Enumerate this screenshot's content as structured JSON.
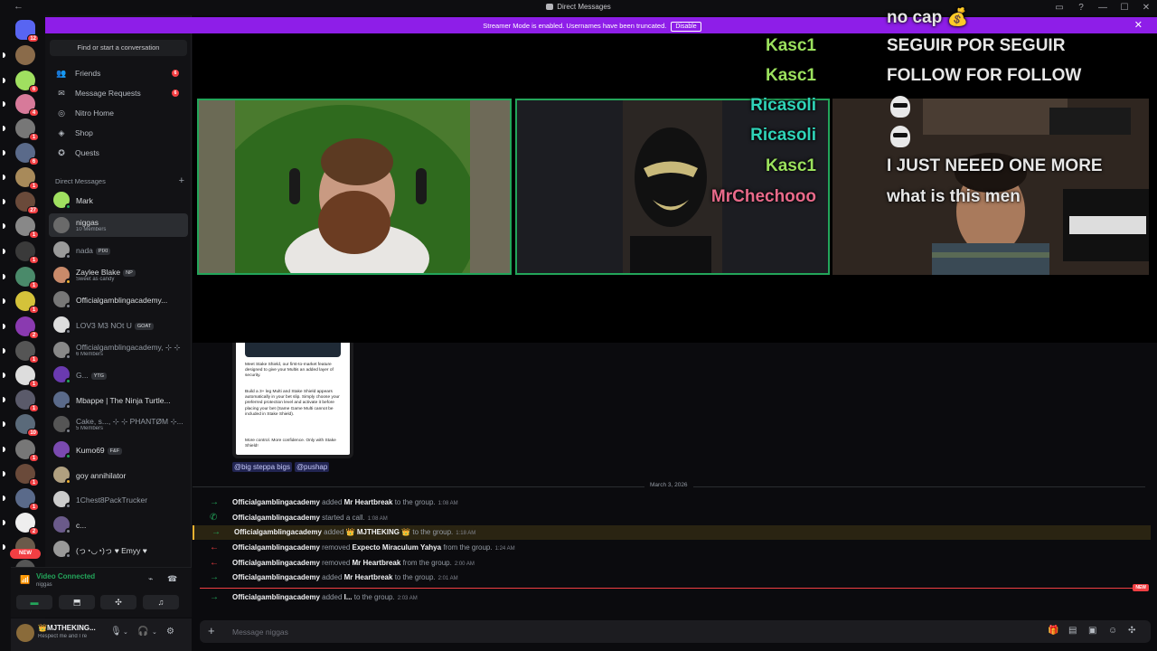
{
  "titlebar": {
    "back": "←",
    "title": "Direct Messages",
    "controls": [
      "▭",
      "?",
      "—",
      "☐",
      "✕"
    ]
  },
  "banner": {
    "text": "Streamer Mode is enabled. Usernames have been truncated.",
    "button": "Disable",
    "close": "✕"
  },
  "rail": {
    "badges": [
      "12",
      "",
      "6",
      "4",
      "1",
      "6",
      "1",
      "27",
      "1",
      "1",
      "1",
      "1",
      "2",
      "1",
      "1",
      "1",
      "10",
      "1",
      "1",
      "1",
      "2",
      "1",
      "1",
      "1"
    ],
    "new_pill": "NEW"
  },
  "sidebar": {
    "search_label": "Find or start a conversation",
    "nav": [
      {
        "label": "Friends",
        "count": "6"
      },
      {
        "label": "Message Requests",
        "count": "6"
      },
      {
        "label": "Nitro Home",
        "count": ""
      },
      {
        "label": "Shop",
        "count": ""
      },
      {
        "label": "Quests",
        "count": ""
      }
    ],
    "dm_header": "Direct Messages",
    "dms": [
      {
        "name": "Mark",
        "sub": "",
        "tag": ""
      },
      {
        "name": "niggas",
        "sub": "10 Members",
        "tag": ""
      },
      {
        "name": "nada",
        "sub": "",
        "tag": "PIXI"
      },
      {
        "name": "Zaylee Blake",
        "sub": "Sweet as candy",
        "tag": "NP"
      },
      {
        "name": "Officialgamblingacademy...",
        "sub": "",
        "tag": ""
      },
      {
        "name": "LOV3 M3 NOt U",
        "sub": "",
        "tag": "GOAT"
      },
      {
        "name": "Officialgamblingacademy, ⊹ ⊹",
        "sub": "6 Members",
        "tag": ""
      },
      {
        "name": "G...",
        "sub": "",
        "tag": "YTG"
      },
      {
        "name": "Mbappe | The Ninja Turtle...",
        "sub": "",
        "tag": ""
      },
      {
        "name": "Cake, s..., ⊹ ⊹ PHANTØM ⊹...",
        "sub": "5 Members",
        "tag": ""
      },
      {
        "name": "Kumo69",
        "sub": "",
        "tag": "F&F"
      },
      {
        "name": "goy annihilator",
        "sub": "",
        "tag": ""
      },
      {
        "name": "1Chest8PackTrucker",
        "sub": "",
        "tag": ""
      },
      {
        "name": "c...",
        "sub": "",
        "tag": ""
      },
      {
        "name": "(っ◔◡◔)っ ♥ Emyy ♥",
        "sub": "",
        "tag": ""
      }
    ]
  },
  "voice": {
    "title": "Video Connected",
    "channel": "niggas"
  },
  "user": {
    "name": "👑MJTHEKING...",
    "status": "Respect me and I re"
  },
  "overlay_chat": [
    {
      "user": "",
      "text": "no cap 💰",
      "color": "#ffffff"
    },
    {
      "user": "Kasc1",
      "text": "SEGUIR POR SEGUIR",
      "color": "#9be15d"
    },
    {
      "user": "Kasc1",
      "text": "FOLLOW FOR FOLLOW",
      "color": "#9be15d"
    },
    {
      "user": "Ricasoli",
      "text": "",
      "color": "#2fd4b8"
    },
    {
      "user": "Ricasoli",
      "text": "",
      "color": "#2fd4b8"
    },
    {
      "user": "Kasc1",
      "text": "I JUST NEEED ONE MORE",
      "color": "#9be15d"
    },
    {
      "user": "MrChechooo",
      "text": "what is this men",
      "color": "#e86a8a"
    }
  ],
  "embed": {
    "paragraphs": [
      "Meet Stake Shield, our first-to-market feature designed to give your Multis an added layer of security.",
      "Build a 3+ leg Multi and Stake Shield appears automatically in your bet slip. Simply choose your preferred protection level and activate it before placing your bet (Same Game Multi cannot be included in Stake Shield).",
      "More control. More confidence. Only with Stake Shield!"
    ],
    "mentions": [
      "@big steppa bigs",
      "@pushap"
    ]
  },
  "date_divider": "March 3, 2026",
  "messages": [
    {
      "icon": "→",
      "icon_color": "#23a55a",
      "user": "Officialgamblingacademy",
      "action": "added",
      "target": "Mr Heartbreak",
      "suffix": "to the group.",
      "time": "1:08 AM",
      "highlight": false
    },
    {
      "icon": "✆",
      "icon_color": "#23a55a",
      "user": "Officialgamblingacademy",
      "action": "started a call.",
      "target": "",
      "suffix": "",
      "time": "1:08 AM",
      "highlight": false
    },
    {
      "icon": "→",
      "icon_color": "#23a55a",
      "user": "Officialgamblingacademy",
      "action": "added",
      "target": "👑 MJTHEKING 👑",
      "suffix": "to the group.",
      "time": "1:18 AM",
      "highlight": true
    },
    {
      "icon": "←",
      "icon_color": "#f23f43",
      "user": "Officialgamblingacademy",
      "action": "removed",
      "target": "Expecto Miraculum Yahya",
      "suffix": "from the group.",
      "time": "1:24 AM",
      "highlight": false
    },
    {
      "icon": "←",
      "icon_color": "#f23f43",
      "user": "Officialgamblingacademy",
      "action": "removed",
      "target": "Mr Heartbreak",
      "suffix": "from the group.",
      "time": "2:00 AM",
      "highlight": false
    },
    {
      "icon": "→",
      "icon_color": "#23a55a",
      "user": "Officialgamblingacademy",
      "action": "added",
      "target": "Mr Heartbreak",
      "suffix": "to the group.",
      "time": "2:01 AM",
      "highlight": false
    },
    {
      "icon": "→",
      "icon_color": "#23a55a",
      "user": "Officialgamblingacademy",
      "action": "added",
      "target": "I...",
      "suffix": "to the group.",
      "time": "2:03 AM",
      "highlight": false
    }
  ],
  "new_label": "NEW",
  "composer": {
    "placeholder": "Message niggas"
  }
}
